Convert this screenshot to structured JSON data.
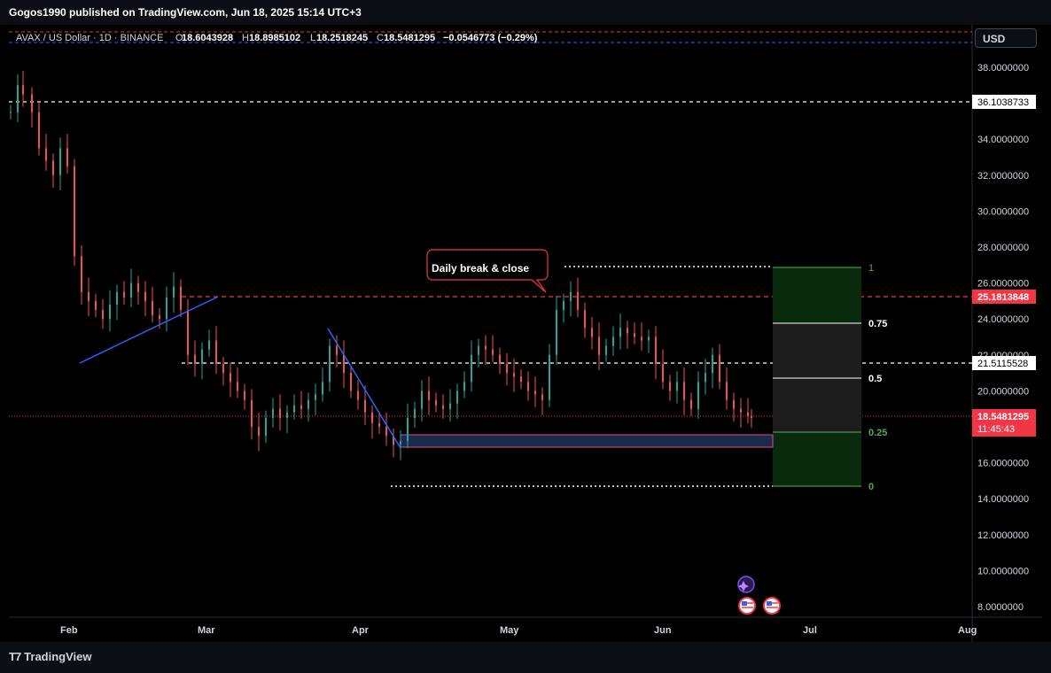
{
  "header": {
    "publisher_text": "Gogos1990 published on TradingView.com, Jun 18, 2025 15:14 UTC+3"
  },
  "legend": {
    "symbol": "AVAX / US Dollar · 1D · BINANCE",
    "open_label": "O",
    "open": "18.6043928",
    "high_label": "H",
    "high": "18.8985102",
    "low_label": "L",
    "low": "18.2518245",
    "close_label": "C",
    "close": "18.5481295",
    "change": "−0.0546773 (−0.29%)"
  },
  "currency_button": "USD",
  "price_axis": {
    "ticks": [
      "38.0000000",
      "36.0000000",
      "34.0000000",
      "32.0000000",
      "30.0000000",
      "28.0000000",
      "26.0000000",
      "24.0000000",
      "22.0000000",
      "20.0000000",
      "18.0000000",
      "16.0000000",
      "14.0000000",
      "12.0000000",
      "10.0000000",
      "8.0000000"
    ],
    "tick_values": [
      38,
      36,
      34,
      32,
      30,
      28,
      26,
      24,
      22,
      20,
      18,
      16,
      14,
      12,
      10,
      8
    ]
  },
  "time_axis": {
    "labels": [
      "Feb",
      "Mar",
      "Apr",
      "May",
      "Jun",
      "Jul",
      "Aug"
    ]
  },
  "price_labels": {
    "level_top": "36.1038733",
    "level_red": "25.1813848",
    "level_mid": "21.5115528",
    "current_price": "18.5481295",
    "countdown": "11:45:43"
  },
  "annotation": {
    "text": "Daily break & close"
  },
  "fib": {
    "levels": [
      "1",
      "0.75",
      "0.5",
      "0.25",
      "0"
    ]
  },
  "colors": {
    "bull": "#26a69a",
    "bear": "#ef5350",
    "accent_red": "#f23645",
    "fib_green": "#4caf50",
    "trend_blue": "#2962ff"
  },
  "footer": {
    "brand": "TradingView"
  },
  "chart_data": {
    "type": "candlestick",
    "symbol": "AVAX / US Dollar",
    "interval": "1D",
    "exchange": "BINANCE",
    "ylim": [
      7.5,
      40.5
    ],
    "horizontal_levels": [
      36.1038733,
      25.1813848,
      21.5115528,
      18.5481295
    ],
    "fib_retracement": {
      "level_1": 26.9,
      "level_0": 14.7
    },
    "trend_lines": [
      {
        "from": [
          "Feb",
          21.5
        ],
        "to": [
          "Mar",
          25.2
        ]
      },
      {
        "from": [
          "Mar",
          23.4
        ],
        "to": [
          "Apr",
          17.0
        ]
      }
    ],
    "demand_zone": {
      "top": 17.5,
      "bottom": 16.8
    },
    "last_close": 18.5481295
  }
}
